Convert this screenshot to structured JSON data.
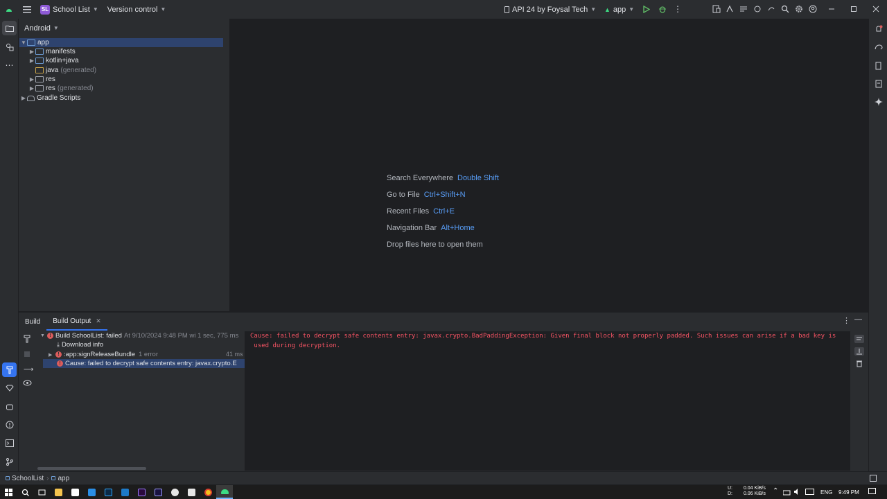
{
  "titlebar": {
    "project_badge": "SL",
    "project_name": "School List",
    "vcs_label": "Version control",
    "device": "API 24 by Foysal Tech",
    "run_config": "app"
  },
  "project_panel": {
    "view_mode": "Android",
    "tree": [
      {
        "label": "app",
        "suffix": ""
      },
      {
        "label": "manifests",
        "suffix": ""
      },
      {
        "label": "kotlin+java",
        "suffix": ""
      },
      {
        "label": "java",
        "suffix": "(generated)"
      },
      {
        "label": "res",
        "suffix": ""
      },
      {
        "label": "res",
        "suffix": "(generated)"
      },
      {
        "label": "Gradle Scripts",
        "suffix": ""
      }
    ]
  },
  "editor_hints": [
    {
      "action": "Search Everywhere",
      "shortcut": "Double Shift"
    },
    {
      "action": "Go to File",
      "shortcut": "Ctrl+Shift+N"
    },
    {
      "action": "Recent Files",
      "shortcut": "Ctrl+E"
    },
    {
      "action": "Navigation Bar",
      "shortcut": "Alt+Home"
    },
    {
      "action": "Drop files here to open them",
      "shortcut": ""
    }
  ],
  "build_panel": {
    "tabs": [
      "Build",
      "Build Output"
    ],
    "tree": [
      {
        "label": "Build SchoolList:",
        "status": "failed",
        "meta": "At 9/10/2024 9:48 PM wi 1 sec, 775 ms"
      },
      {
        "label": "Download info",
        "meta": ""
      },
      {
        "label": ":app:signReleaseBundle",
        "meta": "1 error",
        "time": "41 ms"
      },
      {
        "label": "Cause: failed to decrypt safe contents entry: javax.crypto.E",
        "meta": ""
      }
    ],
    "output_lines": [
      "Cause: failed to decrypt safe contents entry: javax.crypto.BadPaddingException: Given final block not properly padded. Such issues can arise if a bad key is",
      " used during decryption."
    ]
  },
  "statusbar": {
    "breadcrumb_project": "SchoolList",
    "breadcrumb_module": "app"
  },
  "taskbar": {
    "net_up": "0.04 KiB/s",
    "net_down": "0.06 KiB/s",
    "net_up_label": "U:",
    "net_down_label": "D:",
    "language": "ENG",
    "time": "9:49 PM"
  }
}
